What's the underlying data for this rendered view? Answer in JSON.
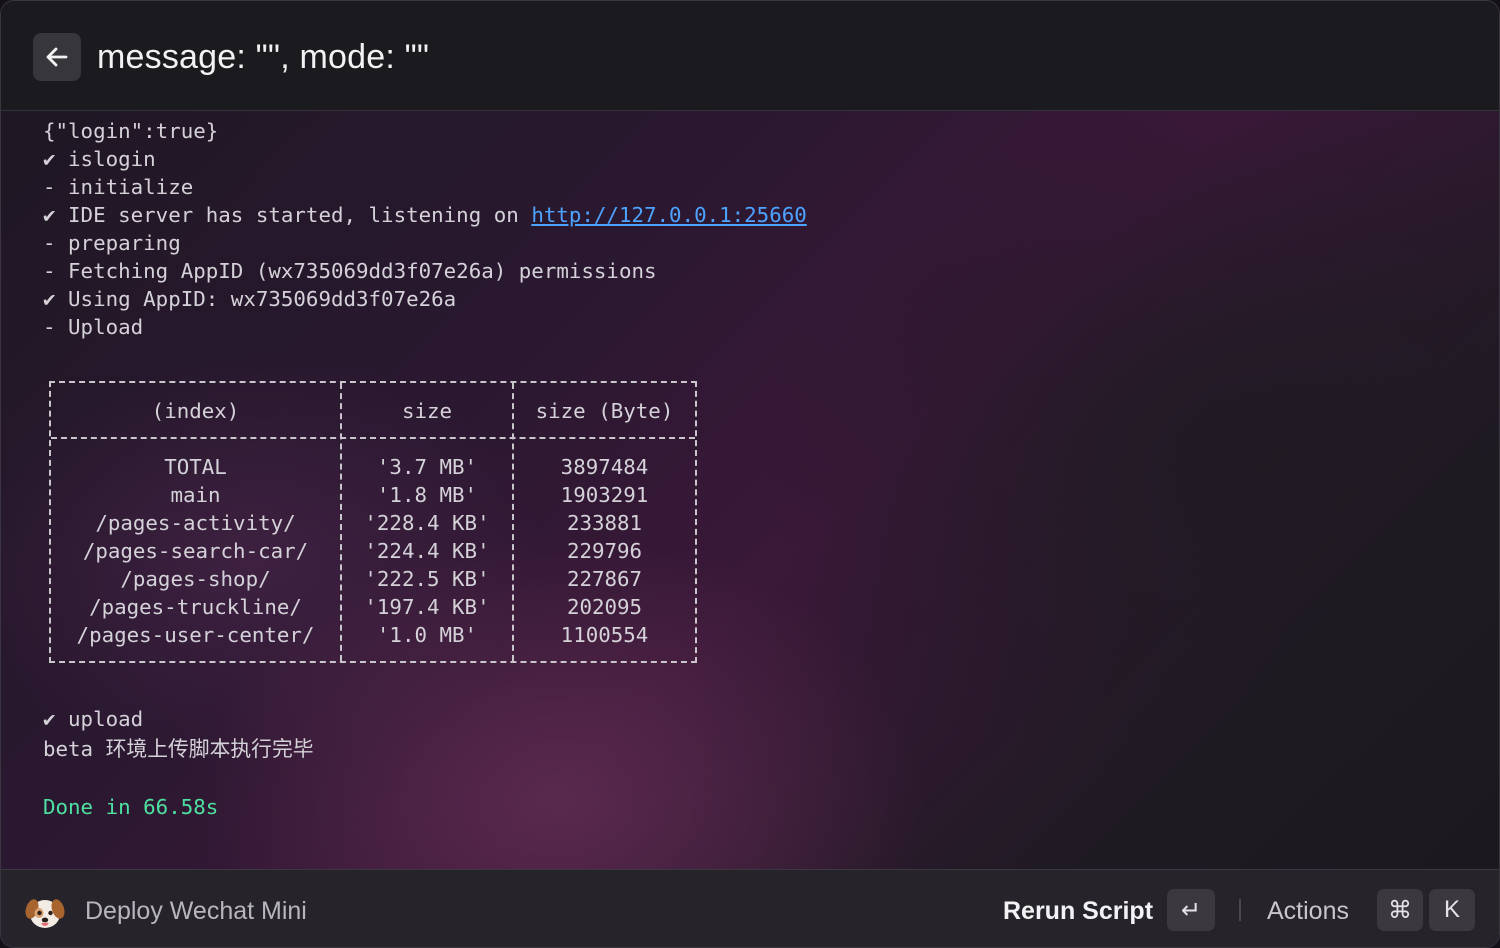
{
  "header": {
    "title": "message: \"\", mode: \"\"",
    "back_icon": "arrow-left-icon"
  },
  "terminal": {
    "lines": [
      "{\"login\":true}",
      "✔ islogin",
      "- initialize",
      "✔ IDE server has started, listening on ",
      "- preparing",
      "- Fetching AppID (wx735069dd3f07e26a) permissions",
      "✔ Using AppID: wx735069dd3f07e26a",
      "- Upload"
    ],
    "server_url": "http://127.0.0.1:25660",
    "table": {
      "headers": [
        "(index)",
        "size",
        "size (Byte)"
      ],
      "rows": [
        [
          "TOTAL",
          "'3.7 MB'",
          "3897484"
        ],
        [
          "main",
          "'1.8 MB'",
          "1903291"
        ],
        [
          "/pages-activity/",
          "'228.4 KB'",
          "233881"
        ],
        [
          "/pages-search-car/",
          "'224.4 KB'",
          "229796"
        ],
        [
          "/pages-shop/",
          "'222.5 KB'",
          "227867"
        ],
        [
          "/pages-truckline/",
          "'197.4 KB'",
          "202095"
        ],
        [
          "/pages-user-center/",
          "'1.0 MB'",
          "1100554"
        ]
      ]
    },
    "after_lines": [
      "✔ upload",
      "beta 环境上传脚本执行完毕"
    ],
    "done_text": "Done in 66.58s",
    "done_color": "#4ee0a0",
    "link_color": "#4da3ff"
  },
  "footer": {
    "app_icon": "dog-face-icon",
    "app_name": "Deploy Wechat Mini",
    "primary_action": "Rerun Script",
    "primary_key": "↵",
    "secondary_action": "Actions",
    "secondary_keys": [
      "⌘",
      "K"
    ]
  }
}
